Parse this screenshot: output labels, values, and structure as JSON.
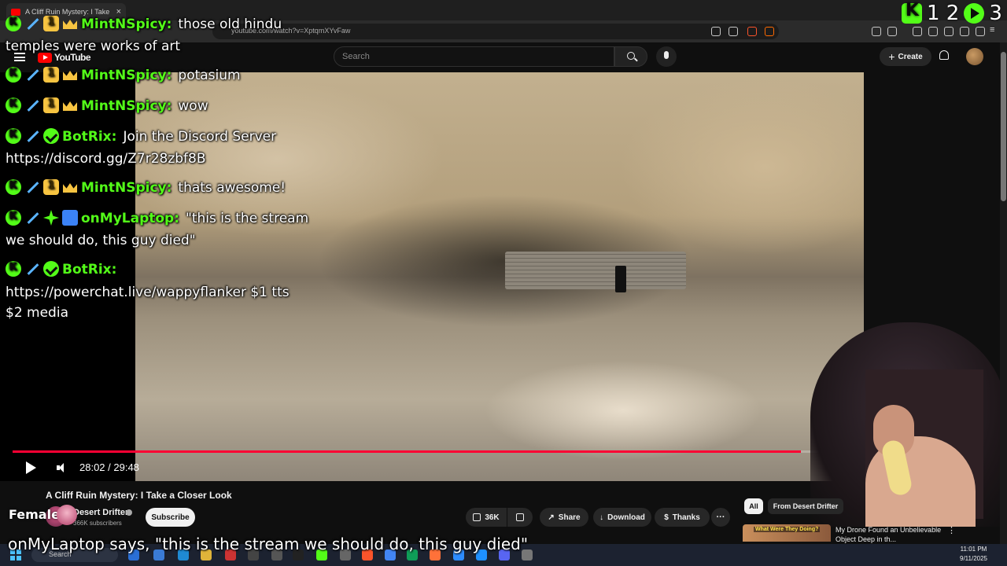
{
  "browser": {
    "tab_title": "A Cliff Ruin Mystery: I Take a Clo",
    "tab_close": "×",
    "url": "youtube.com/watch?v=XptqmXYvFaw"
  },
  "youtube": {
    "logo_text": "YouTube",
    "search_placeholder": "Search",
    "create_label": "Create"
  },
  "video": {
    "time": "28:02 / 29:48",
    "progress_fraction": 0.94,
    "title": "A Cliff Ruin Mystery: I Take a Closer Look"
  },
  "channel": {
    "name": "Desert Drifter",
    "subscribers": "366K subscribers",
    "subscribe_label": "Subscribe"
  },
  "actions": {
    "likes": "36K",
    "share": "Share",
    "download": "Download",
    "thanks": "Thanks",
    "more": "···"
  },
  "sidebar": {
    "chip_all": "All",
    "chip_from": "From Desert Drifter",
    "rec_thumb_text": "What Were They Doing?",
    "rec_title": "My Drone Found an Unbelievable Object Deep in th...",
    "rec_more": "⋮"
  },
  "chat": {
    "messages": [
      {
        "user": "MintNSpicy:",
        "text": "those old hindu",
        "cont": "temples were works of art"
      },
      {
        "user": "MintNSpicy:",
        "text": "potasium"
      },
      {
        "user": "MintNSpicy:",
        "text": "wow"
      },
      {
        "user": "BotRix:",
        "text": "Join the Discord Server",
        "cont": "https://discord.gg/Z7r28zbf8B"
      },
      {
        "user": "MintNSpicy:",
        "text": "thats awesome!"
      },
      {
        "user": "onMyLaptop:",
        "text": "\"this is the stream",
        "cont": "we should do, this guy died\""
      },
      {
        "user": "BotRix:",
        "text": "",
        "cont": "https://powerchat.live/wappyflanker $1 tts",
        "cont2": "$2 media"
      }
    ]
  },
  "counters": {
    "kick": "1 2",
    "viewers": "3"
  },
  "overlay": {
    "female_label": "Female",
    "tts_caption": "onMyLaptop says, \"this is the stream we should do, this guy died\""
  },
  "taskbar": {
    "search_text": "Search",
    "time": "11:01 PM",
    "date": "9/11/2025"
  }
}
